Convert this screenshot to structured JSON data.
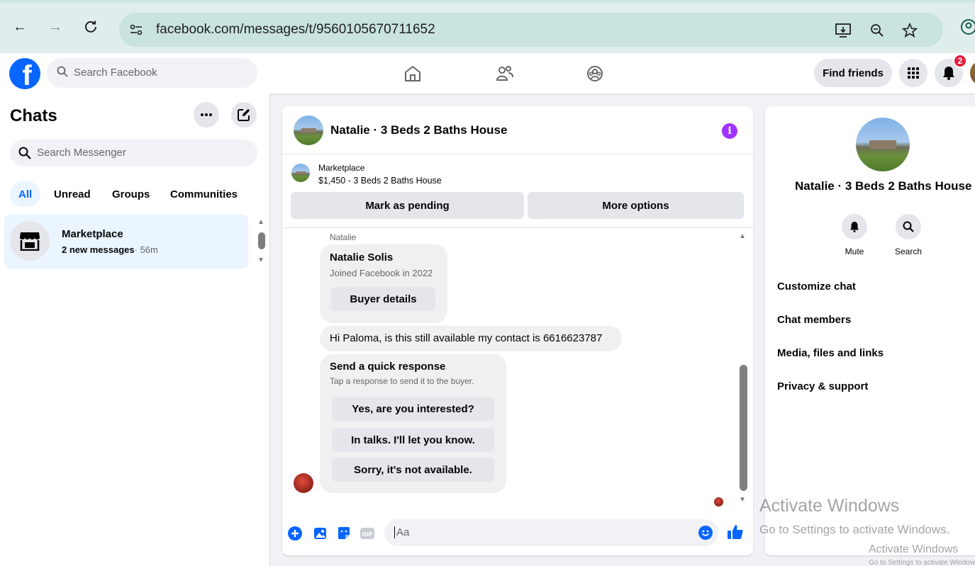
{
  "browser": {
    "url": "facebook.com/messages/t/9560105670711652"
  },
  "header": {
    "search_placeholder": "Search Facebook",
    "find_friends": "Find friends",
    "notification_count": "2"
  },
  "sidebar": {
    "title": "Chats",
    "search_placeholder": "Search Messenger",
    "filters": [
      "All",
      "Unread",
      "Groups",
      "Communities"
    ],
    "active_filter": "All",
    "chats": [
      {
        "name": "Marketplace",
        "preview": "2 new messages",
        "time": "· 56m"
      }
    ]
  },
  "conversation": {
    "title": "Natalie · 3 Beds 2 Baths House",
    "listing_label": "Marketplace",
    "listing_price": "$1,450 - 3 Beds 2 Baths House",
    "mark_pending": "Mark as pending",
    "more_options": "More options",
    "sender_label": "Natalie",
    "buyer_card": {
      "name": "Natalie Solis",
      "joined": "Joined Facebook in 2022",
      "button": "Buyer details"
    },
    "message": "Hi Paloma, is this still available my contact is 6616623787",
    "quick_response": {
      "title": "Send a quick response",
      "subtitle": "Tap a response to send it to the buyer.",
      "options": [
        "Yes, are you interested?",
        "In talks. I'll let you know.",
        "Sorry, it's not available."
      ]
    },
    "composer_placeholder": "Aa"
  },
  "info_panel": {
    "name": "Natalie · 3 Beds 2 Baths House",
    "actions": [
      "Mute",
      "Search"
    ],
    "links": [
      "Customize chat",
      "Chat members",
      "Media, files and links",
      "Privacy & support"
    ]
  },
  "watermark": {
    "title": "Activate Windows",
    "subtitle": "Go to Settings to activate Windows.",
    "title2": "Activate Windows",
    "subtitle2": "Go to Settings to activate Windows."
  },
  "colors": {
    "fb_blue": "#0866ff",
    "active_bg": "#ebf5ff",
    "badge_red": "#e41e3f",
    "info_purple": "#a033ff"
  }
}
